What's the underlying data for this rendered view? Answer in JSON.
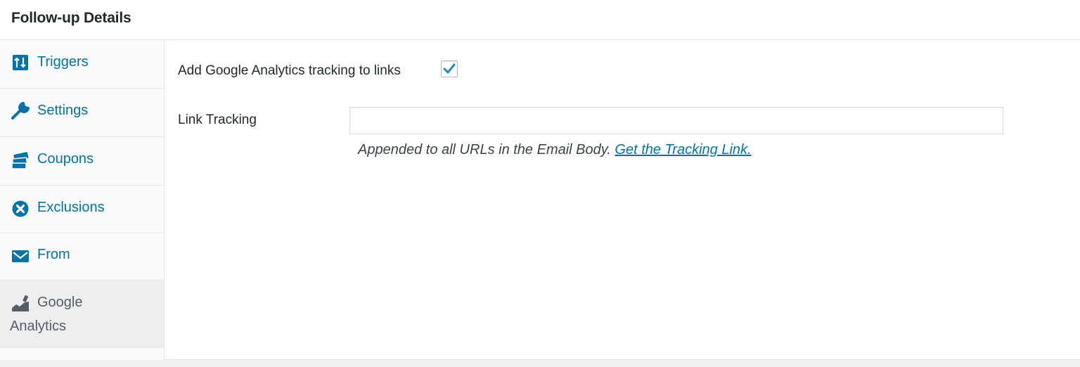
{
  "panel": {
    "title": "Follow-up Details"
  },
  "sidebar": {
    "tabs": [
      {
        "label": "Triggers",
        "icon": "triggers-icon"
      },
      {
        "label": "Settings",
        "icon": "wrench-icon"
      },
      {
        "label": "Coupons",
        "icon": "tickets-icon"
      },
      {
        "label": "Exclusions",
        "icon": "close-circle-icon"
      },
      {
        "label": "From",
        "icon": "envelope-icon"
      },
      {
        "label_line1": "Google",
        "label_line2": "Analytics",
        "icon": "chart-icon",
        "active": true
      }
    ]
  },
  "main": {
    "ga_tracking": {
      "label": "Add Google Analytics tracking to links",
      "checked": true
    },
    "link_tracking": {
      "label": "Link Tracking",
      "value": "",
      "placeholder": ""
    },
    "description": {
      "text": "Appended to all URLs in the Email Body.",
      "link_text": "Get the Tracking Link."
    }
  },
  "colors": {
    "link": "#0073aa",
    "active_tab_bg": "#eeeeee",
    "sidebar_bg": "#fafafa",
    "checkmark": "#1e8cbe"
  }
}
